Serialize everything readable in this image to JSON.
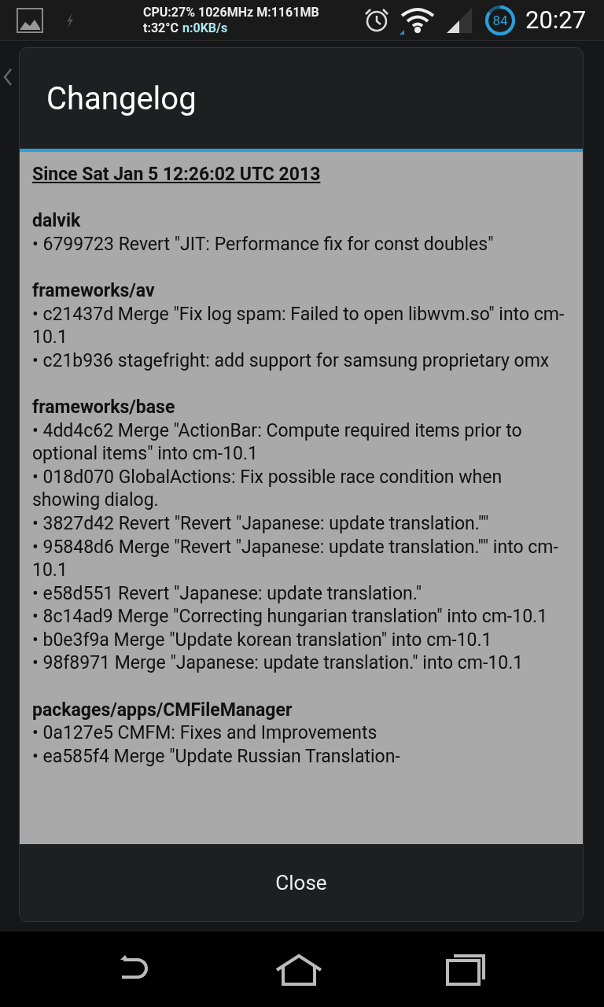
{
  "status_bar": {
    "cpu": "CPU:27% 1026MHz M:1161MB",
    "temp": "t:32°C",
    "net": "n:0KB/s",
    "battery": "84",
    "time": "20:27"
  },
  "dialog": {
    "title": "Changelog",
    "since": "Since Sat Jan 5 12:26:02 UTC 2013",
    "sections": [
      {
        "name": "dalvik",
        "entries": [
          "• 6799723 Revert \"JIT: Performance fix for const doubles\""
        ]
      },
      {
        "name": "frameworks/av",
        "entries": [
          "• c21437d Merge \"Fix log spam: Failed to open libwvm.so\" into cm-10.1",
          "• c21b936 stagefright: add support for samsung proprietary omx"
        ]
      },
      {
        "name": "frameworks/base",
        "entries": [
          "• 4dd4c62 Merge \"ActionBar: Compute required items prior to optional items\" into cm-10.1",
          "• 018d070 GlobalActions: Fix possible race condition when showing dialog.",
          "• 3827d42 Revert \"Revert \"Japanese: update translation.\"\"",
          "• 95848d6 Merge \"Revert \"Japanese: update translation.\"\" into cm-10.1",
          "• e58d551 Revert \"Japanese: update translation.\"",
          "• 8c14ad9 Merge \"Correcting hungarian translation\" into cm-10.1",
          "• b0e3f9a Merge \"Update korean translation\" into cm-10.1",
          "• 98f8971 Merge \"Japanese: update translation.\" into cm-10.1"
        ]
      },
      {
        "name": "packages/apps/CMFileManager",
        "entries": [
          "• 0a127e5 CMFM: Fixes and Improvements",
          "• ea585f4 Merge \"Update Russian Translation-"
        ]
      }
    ],
    "button": "Close"
  }
}
